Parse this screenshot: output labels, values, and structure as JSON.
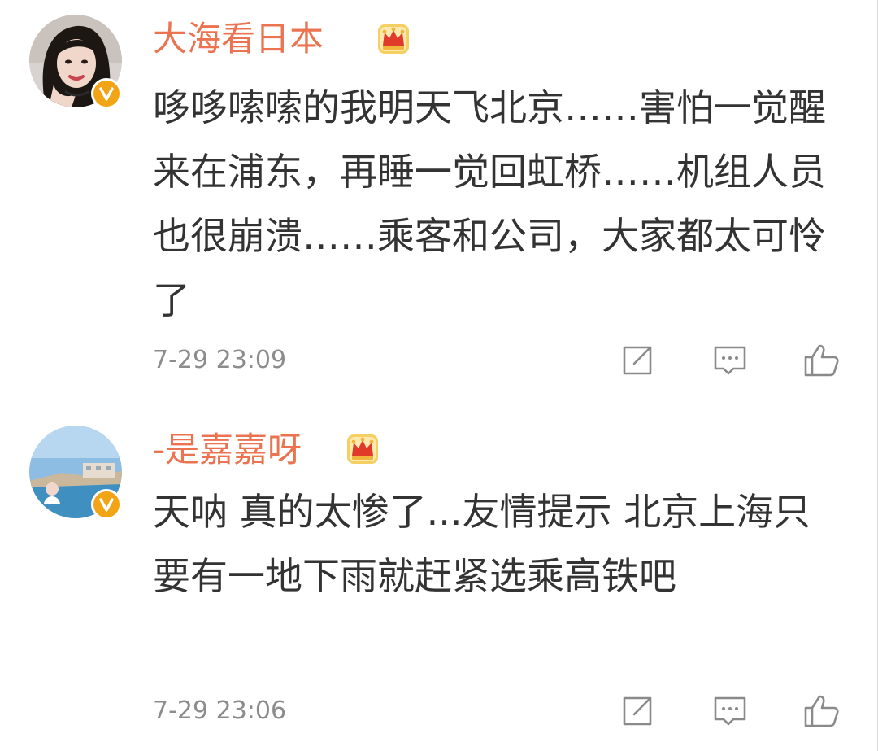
{
  "comments": [
    {
      "username": "大海看日本",
      "avatar_icon": "avatar-photo-woman",
      "verified_icon": "verified-v-badge-icon",
      "member_icon": "vip-crown-icon",
      "content": "哆哆嗦嗦的我明天飞北京……害怕一觉醒来在浦东，再睡一觉回虹桥……机组人员也很崩溃……乘客和公司，大家都太可怜了",
      "time": "7-29 23:09",
      "actions": [
        "forward-icon",
        "reply-icon",
        "like-icon"
      ]
    },
    {
      "username": "-是嘉嘉呀",
      "avatar_icon": "avatar-photo-beach",
      "verified_icon": "verified-v-badge-icon",
      "member_icon": "vip-crown-icon",
      "content": "天呐 真的太惨了...友情提示 北京上海只要有一地下雨就赶紧选乘高铁吧",
      "time": "7-29 23:06",
      "actions": [
        "forward-icon",
        "reply-icon",
        "like-icon"
      ]
    }
  ],
  "colors": {
    "username": "#eb7350",
    "content": "#333333",
    "time": "#8c8c8c",
    "icon": "#8a8a8a",
    "verified_badge": "#f2a417",
    "crown_gold": "#f0b53a",
    "crown_red": "#e03b2a"
  }
}
